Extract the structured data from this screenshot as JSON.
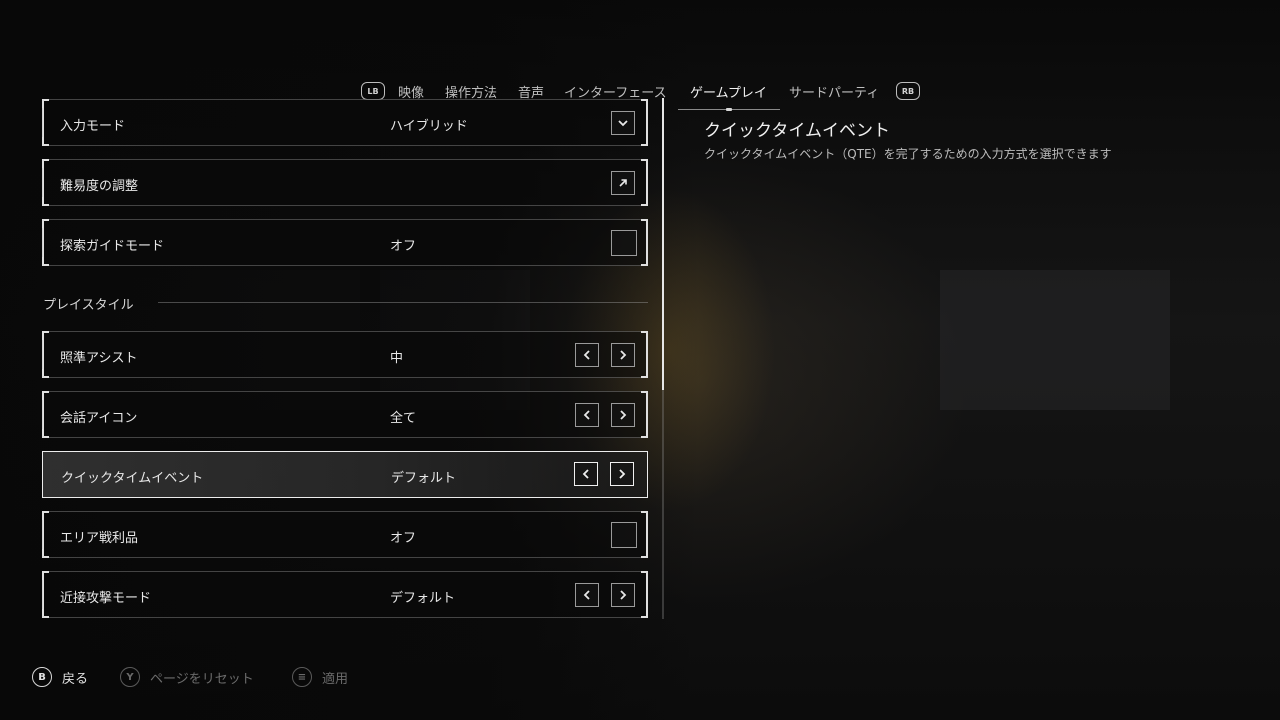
{
  "tabs": {
    "left_badge": "LB",
    "right_badge": "RB",
    "items": [
      "映像",
      "操作方法",
      "音声",
      "インターフェース",
      "ゲームプレイ",
      "サードパーティ"
    ],
    "active": "ゲームプレイ"
  },
  "settings": {
    "input_mode": {
      "label": "入力モード",
      "value": "ハイブリッド",
      "control": "dropdown"
    },
    "difficulty": {
      "label": "難易度の調整",
      "control": "open-external"
    },
    "explore_guide": {
      "label": "探索ガイドモード",
      "value": "オフ",
      "control": "checkbox",
      "checked": false
    },
    "section_playstyle": "プレイスタイル",
    "aim_assist": {
      "label": "照準アシスト",
      "value": "中",
      "control": "arrows"
    },
    "dialogue_icon": {
      "label": "会話アイコン",
      "value": "全て",
      "control": "arrows"
    },
    "qte": {
      "label": "クイックタイムイベント",
      "value": "デフォルト",
      "control": "arrows",
      "selected": true
    },
    "area_loot": {
      "label": "エリア戦利品",
      "value": "オフ",
      "control": "checkbox",
      "checked": false
    },
    "melee_mode": {
      "label": "近接攻撃モード",
      "value": "デフォルト",
      "control": "arrows"
    }
  },
  "description": {
    "title": "クイックタイムイベント",
    "text": "クイックタイムイベント（QTE）を完了するための入力方式を選択できます"
  },
  "footer": {
    "back": {
      "key": "B",
      "label": "戻る"
    },
    "reset": {
      "key": "Y",
      "label": "ページをリセット",
      "enabled": false
    },
    "apply": {
      "key": "≡",
      "label": "適用",
      "enabled": false
    }
  },
  "colors": {
    "text": "#e8e8e8",
    "background": "#0b0b0b",
    "selected_border": "#ededed",
    "dim": "#6c6c6c"
  }
}
